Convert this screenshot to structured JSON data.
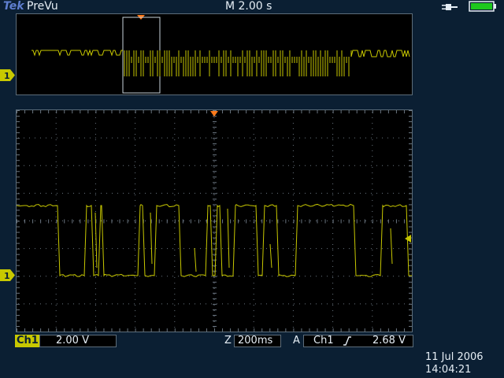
{
  "header": {
    "brand": "Tek",
    "mode": "PreVu",
    "timebase": "M 2.00 s"
  },
  "overview": {
    "channel_marker": "1"
  },
  "main": {
    "channel_marker": "1"
  },
  "status": {
    "channel": "Ch1",
    "channel_scale": "2.00 V",
    "zoom_label": "Z",
    "zoom_value": "200ms",
    "trigger_mode": "A",
    "trigger_source": "Ch1",
    "trigger_level": "2.68 V"
  },
  "datetime": {
    "date": "11 Jul  2006",
    "time": "14:04:21"
  },
  "colors": {
    "trace": "#c8c800",
    "trigger_marker": "#ff7a1a",
    "background": "#0b1f33"
  }
}
